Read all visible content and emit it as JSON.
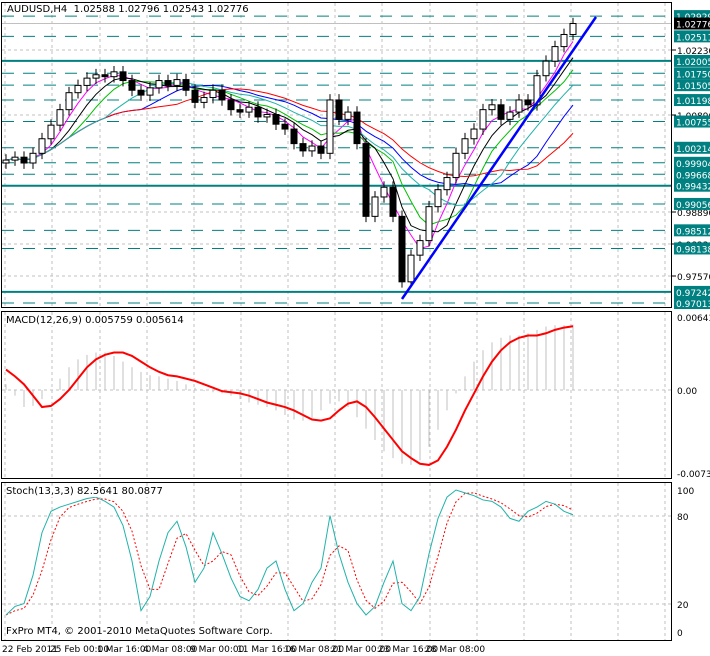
{
  "header": {
    "symbol": "AUDUSD,H4",
    "open": "1.02588",
    "high": "1.02796",
    "low": "1.02543",
    "close": "1.02776"
  },
  "macd_label": "MACD(12,26,9) 0.005759 0.005614",
  "stoch_label": "Stoch(13,3,3) 82.5641 80.0877",
  "copyright": "FxPro MT4, © 2001-2010 MetaQuotes Software Corp.",
  "colors": {
    "level": "#008080",
    "trendline": "#0000ff",
    "macd_signal": "#ff0000",
    "macd_hist": "#c0c0c0",
    "stoch_main": "#20b2aa",
    "stoch_signal": "#ff0000",
    "current_price_bg": "#000000"
  },
  "chart_data": [
    {
      "type": "candlestick",
      "title": "AUDUSD,H4",
      "x_tick_labels": [
        "22 Feb 2011",
        "25 Feb 00:00",
        "1 Mar 16:00",
        "4 Mar 08:00",
        "9 Mar 00:00",
        "11 Mar 16:00",
        "16 Mar 08:00",
        "21 Mar 00:00",
        "23 Mar 16:00",
        "28 Mar 08:00"
      ],
      "y_tick_labels": [
        "1.02230",
        "1.00890",
        "0.98890",
        "0.98230",
        "0.97570"
      ],
      "ylim": [
        0.9695,
        1.03
      ],
      "current_price": "1.02776",
      "levels_solid": [
        "1.02005",
        "0.99432",
        "0.97242"
      ],
      "levels_dashed": [
        "1.02929",
        "1.02511",
        "1.01750",
        "1.01505",
        "1.01198",
        "1.00755",
        "1.00214",
        "0.99904",
        "0.99668",
        "0.99056",
        "0.98512",
        "0.98138",
        "0.97013"
      ],
      "closes": [
        0.9996,
        1.0002,
        0.999,
        1.001,
        1.004,
        1.0068,
        1.01,
        1.0135,
        1.015,
        1.0165,
        1.0172,
        1.0168,
        1.0178,
        1.016,
        1.014,
        1.013,
        1.0145,
        1.016,
        1.015,
        1.0162,
        1.014,
        1.0115,
        1.0125,
        1.014,
        1.012,
        1.01,
        1.0095,
        1.0105,
        1.0085,
        1.009,
        1.007,
        1.006,
        1.003,
        1.0015,
        1.0025,
        1.001,
        1.012,
        1.008,
        1.0095,
        1.003,
        0.988,
        0.992,
        0.994,
        0.988,
        0.9745,
        0.98,
        0.983,
        0.99,
        0.9935,
        0.996,
        1.001,
        1.004,
        1.006,
        1.01,
        1.011,
        1.008,
        1.0095,
        1.012,
        1.011,
        1.017,
        1.02,
        1.023,
        1.0255,
        1.02776
      ]
    },
    {
      "type": "macd",
      "y_tick_labels": [
        "0.00643",
        "0.00",
        "-0.00734"
      ],
      "ylim": [
        -0.00734,
        0.00643
      ],
      "main": [
        0.0005,
        -0.0005,
        -0.0015,
        -0.0014,
        -0.0008,
        0.0,
        0.001,
        0.002,
        0.0027,
        0.0031,
        0.0033,
        0.0033,
        0.003,
        0.0025,
        0.002,
        0.0016,
        0.0013,
        0.0012,
        0.001,
        0.0008,
        0.0005,
        0.0002,
        -0.0001,
        -0.0002,
        -0.0003,
        -0.0005,
        -0.0008,
        -0.0011,
        -0.0013,
        -0.0015,
        -0.0018,
        -0.0022,
        -0.0026,
        -0.0027,
        -0.0025,
        -0.0018,
        -0.0012,
        -0.001,
        -0.0015,
        -0.0024,
        -0.0034,
        -0.0044,
        -0.0054,
        -0.006,
        -0.0065,
        -0.0066,
        -0.0062,
        -0.005,
        -0.0035,
        -0.0018,
        -0.0003,
        0.0012,
        0.0025,
        0.0035,
        0.0042,
        0.0046,
        0.0048,
        0.0048,
        0.005,
        0.0053,
        0.0056,
        0.0057,
        0.0057,
        0.005759
      ],
      "signal": [
        0.0018,
        0.0012,
        0.0005,
        -0.0005,
        -0.0015,
        -0.0014,
        -0.0008,
        0.0,
        0.001,
        0.002,
        0.0027,
        0.0031,
        0.0033,
        0.0033,
        0.003,
        0.0025,
        0.002,
        0.0016,
        0.0013,
        0.0012,
        0.001,
        0.0008,
        0.0005,
        0.0002,
        -0.0001,
        -0.0002,
        -0.0003,
        -0.0005,
        -0.0008,
        -0.0011,
        -0.0013,
        -0.0015,
        -0.0018,
        -0.0022,
        -0.0026,
        -0.0027,
        -0.0025,
        -0.0018,
        -0.0012,
        -0.001,
        -0.0015,
        -0.0024,
        -0.0034,
        -0.0044,
        -0.0054,
        -0.006,
        -0.0065,
        -0.0066,
        -0.0062,
        -0.005,
        -0.0035,
        -0.0018,
        -0.0003,
        0.0012,
        0.0025,
        0.0035,
        0.0042,
        0.0046,
        0.0048,
        0.0048,
        0.005,
        0.0053,
        0.0055,
        0.005614
      ]
    },
    {
      "type": "stochastic",
      "y_tick_labels": [
        "100",
        "80",
        "20",
        "0"
      ],
      "ylim": [
        0,
        100
      ],
      "main": [
        12,
        18,
        20,
        40,
        70,
        85,
        88,
        90,
        92,
        94,
        95,
        92,
        88,
        75,
        50,
        15,
        25,
        50,
        70,
        78,
        60,
        35,
        45,
        70,
        55,
        38,
        25,
        22,
        30,
        45,
        50,
        30,
        15,
        20,
        35,
        45,
        82,
        55,
        35,
        20,
        12,
        18,
        35,
        50,
        20,
        15,
        25,
        55,
        80,
        95,
        100,
        98,
        96,
        93,
        92,
        88,
        80,
        78,
        85,
        88,
        92,
        90,
        85,
        82.5641
      ]
    }
  ]
}
